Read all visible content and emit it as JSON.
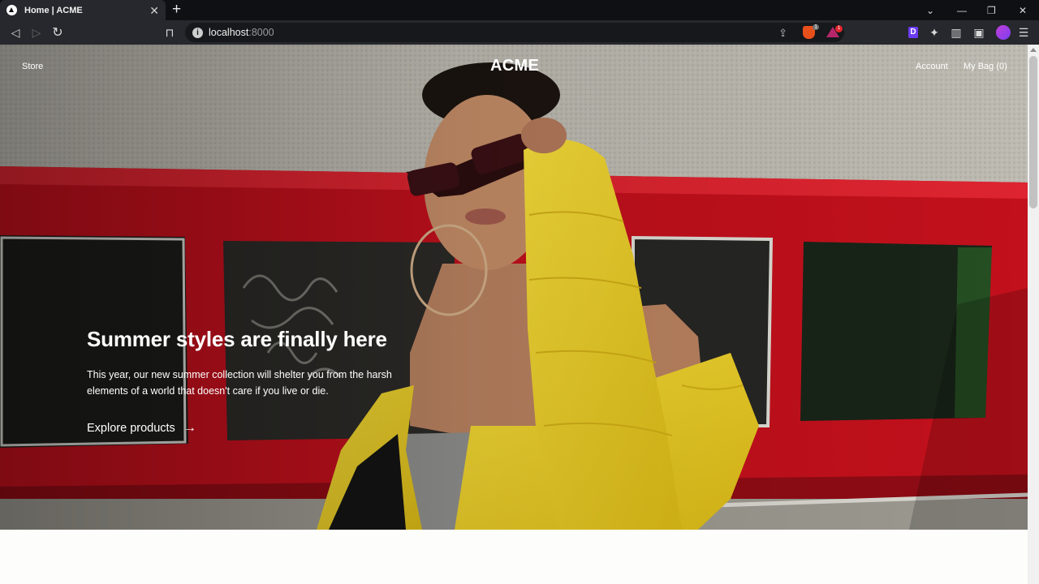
{
  "browser": {
    "tab_title": "Home | ACME",
    "tab_close": "✕",
    "new_tab": "+",
    "url_host": "localhost",
    "url_port": ":8000",
    "brave_shields_count": "1",
    "rewards_badge": "1",
    "extension_letter": "D",
    "window_controls": {
      "chevron": "⌄",
      "minimize": "—",
      "maximize": "❐",
      "close": "✕"
    },
    "toolbar_glyphs": {
      "back": "◁",
      "forward": "▷",
      "reload": "↻",
      "bookmark": "⊓",
      "share": "⇪",
      "puzzle": "✦",
      "sidebar": "▥",
      "wallet": "▣",
      "menu": "☰"
    }
  },
  "site": {
    "nav": {
      "store": "Store",
      "logo": "ACME",
      "account": "Account",
      "bag": "My Bag (0)"
    },
    "hero": {
      "title": "Summer styles are finally here",
      "body": "This year, our new summer collection will shelter you from the harsh elements of a world that doesn't care if you live or die.",
      "cta_label": "Explore products",
      "cta_arrow": "→"
    }
  },
  "colors": {
    "chrome_bg": "#0f1014",
    "toolbar_bg": "#26282d",
    "wall": "#b9b6ad",
    "red_frame": "#c2101c",
    "jacket_yellow": "#f3d629"
  }
}
